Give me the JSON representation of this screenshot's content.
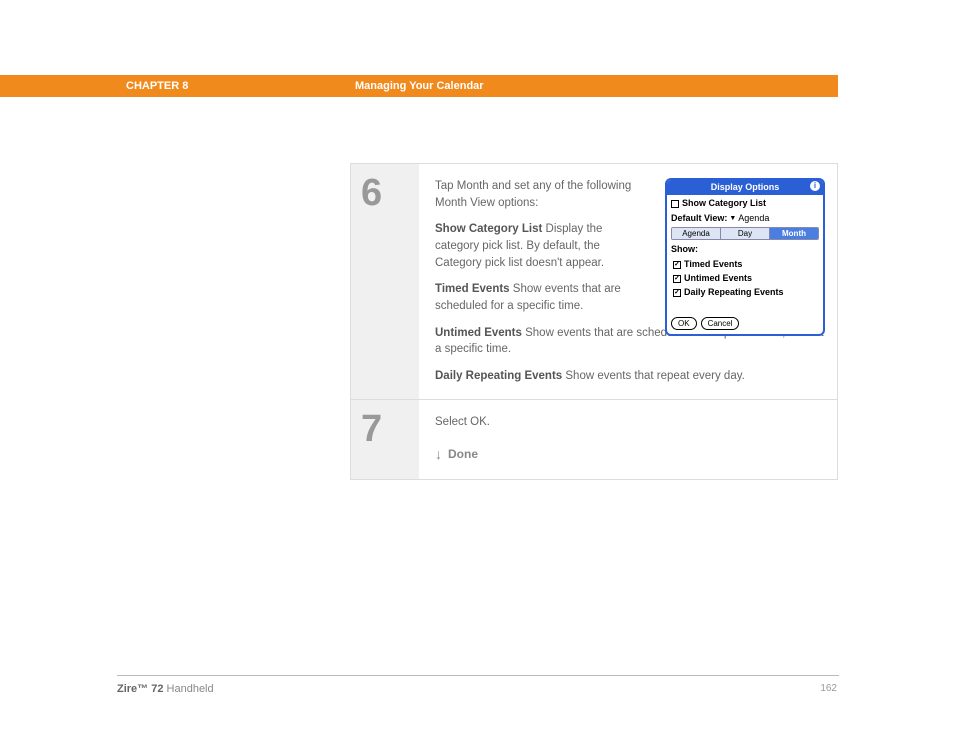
{
  "header": {
    "chapter": "CHAPTER 8",
    "section": "Managing Your Calendar"
  },
  "steps": {
    "s6": {
      "num": "6",
      "intro": "Tap Month and set any of the following Month View options:",
      "opt1_label": "Show Category List",
      "opt1_text": "   Display the category pick list. By default, the Category pick list doesn't appear.",
      "opt2_label": "Timed Events",
      "opt2_text": "   Show events that are scheduled for a specific time.",
      "opt3_label": "Untimed Events",
      "opt3_text": "   Show events that are scheduled for a specific date, but not a specific time.",
      "opt4_label": "Daily Repeating Events",
      "opt4_text": "   Show events that repeat every day."
    },
    "s7": {
      "num": "7",
      "text": "Select OK.",
      "done": "Done"
    }
  },
  "dialog": {
    "title": "Display Options",
    "info": "i",
    "showCatList": "Show Category List",
    "defaultViewLabel": "Default View:",
    "defaultViewValue": "Agenda",
    "tabs": {
      "agenda": "Agenda",
      "day": "Day",
      "month": "Month"
    },
    "showHeading": "Show:",
    "items": {
      "timed": "Timed Events",
      "untimed": "Untimed Events",
      "daily": "Daily Repeating Events"
    },
    "ok": "OK",
    "cancel": "Cancel"
  },
  "footer": {
    "product_bold": "Zire™ 72",
    "product_rest": " Handheld",
    "page": "162"
  }
}
